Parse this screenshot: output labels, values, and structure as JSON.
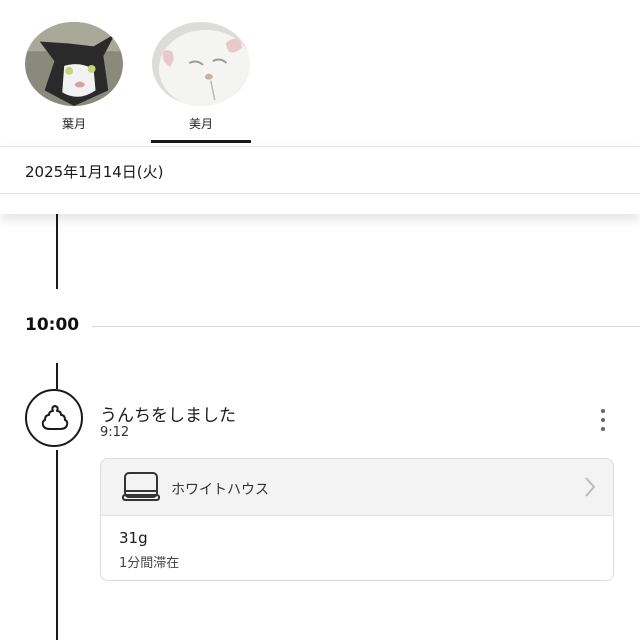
{
  "cats": [
    {
      "name": "葉月",
      "avatar_icon": "cat-photo-avatar",
      "selected": false
    },
    {
      "name": "美月",
      "avatar_icon": "cat-photo-avatar",
      "selected": true
    }
  ],
  "date": "2025年1月14日(火)",
  "timeline": {
    "hour_label": "10:00",
    "event": {
      "icon": "poop-icon",
      "title": "うんちをしました",
      "time": "9:12",
      "device": {
        "icon": "litter-box-icon",
        "name": "ホワイトハウス"
      },
      "weight": "31g",
      "stay": "1分間滞在"
    }
  },
  "colors": {
    "accent": "#1a1a1a",
    "line": "#d8d8d8",
    "card_header_bg": "#f3f3f3"
  }
}
